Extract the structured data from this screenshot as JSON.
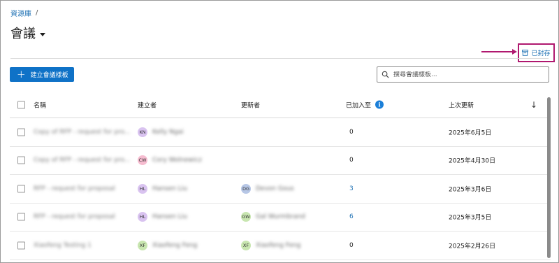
{
  "breadcrumb": {
    "link_label": "資源庫",
    "separator": "/"
  },
  "page": {
    "title": "會議"
  },
  "toolbar": {
    "archived_label": "已封存",
    "create_label": "建立會議樣板",
    "search_placeholder": "搜尋會議樣板..."
  },
  "colors": {
    "accent": "#0f72c7",
    "link": "#1b6fb3",
    "annotation": "#b0186f"
  },
  "table": {
    "headers": {
      "name": "名稱",
      "creator": "建立者",
      "updater": "更新者",
      "added_to": "已加入至",
      "last_updated": "上次更新"
    },
    "rows": [
      {
        "name": "Copy of RFP - request for pro...",
        "creator_initials": "KN",
        "creator_name": "Kelly Ngai",
        "creator_color": "#d9c3f0",
        "updater_initials": "",
        "updater_name": "",
        "updater_color": "",
        "added_count": "0",
        "added_is_link": false,
        "updated": "2025年6月5日"
      },
      {
        "name": "Copy of RFP - request for pro...",
        "creator_initials": "CW",
        "creator_name": "Cory Wolnewicz",
        "creator_color": "#f6bcd0",
        "updater_initials": "",
        "updater_name": "",
        "updater_color": "",
        "added_count": "0",
        "added_is_link": false,
        "updated": "2025年4月30日"
      },
      {
        "name": "RFP - request for proposal",
        "creator_initials": "HL",
        "creator_name": "Hansen Liu",
        "creator_color": "#d9c3f0",
        "updater_initials": "DG",
        "updater_name": "Devon Gous",
        "updater_color": "#b7c7e6",
        "added_count": "3",
        "added_is_link": true,
        "updated": "2025年3月6日"
      },
      {
        "name": "RFP - request for proposal",
        "creator_initials": "HL",
        "creator_name": "Hansen Liu",
        "creator_color": "#d9c3f0",
        "updater_initials": "GW",
        "updater_name": "Gal Wurmbrand",
        "updater_color": "#c8e6b0",
        "added_count": "6",
        "added_is_link": true,
        "updated": "2025年3月5日"
      },
      {
        "name": "Xiaofeng Testing 1",
        "creator_initials": "XF",
        "creator_name": "Xiaofeng Feng",
        "creator_color": "#c8e6b0",
        "updater_initials": "XF",
        "updater_name": "Xiaofeng Feng",
        "updater_color": "#c8e6b0",
        "added_count": "0",
        "added_is_link": false,
        "updated": "2025年2月26日"
      }
    ]
  }
}
